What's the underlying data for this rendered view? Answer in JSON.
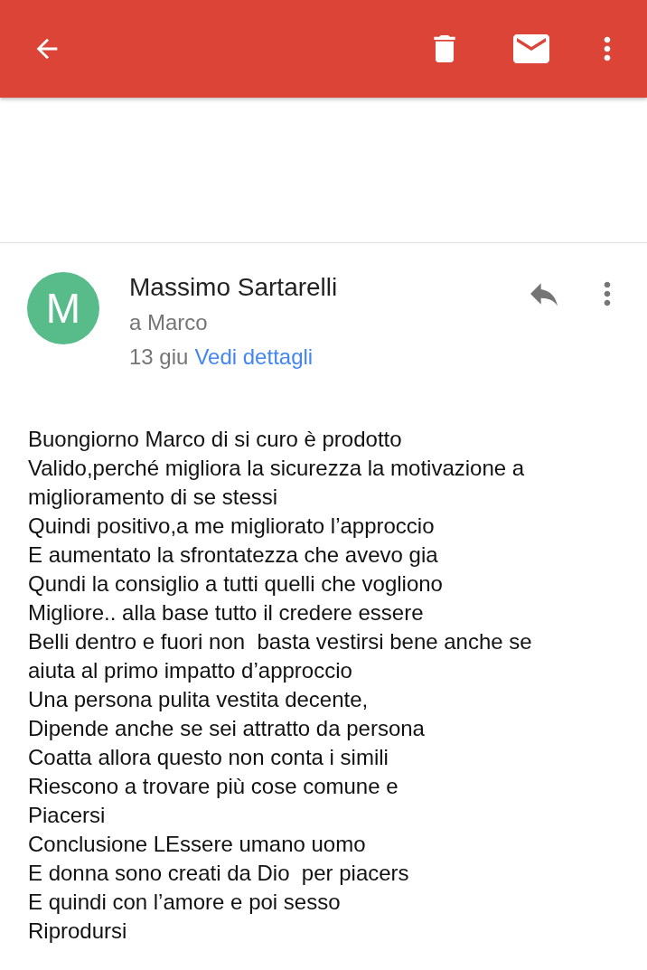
{
  "toolbar": {
    "actions": [
      {
        "kind": "back"
      },
      {
        "kind": "delete"
      },
      {
        "kind": "unread"
      },
      {
        "kind": "more"
      }
    ]
  },
  "message": {
    "sender": "Massimo Sartarelli",
    "avatar_letter": "M",
    "recipient": "a Marco",
    "date": "13 giu",
    "details_link": "Vedi dettagli",
    "body_lines": [
      "Buongiorno Marco di si curo è prodotto",
      "Valido,perché migliora la sicurezza la motivazione a",
      "miglioramento di se stessi",
      "Quindi positivo,a me migliorato l’approccio",
      "E aumentato la sfrontatezza che avevo gia",
      "Qundi la consiglio a tutti quelli che vogliono",
      "Migliore.. alla base tutto il credere essere",
      "Belli dentro e fuori non  basta vestirsi bene anche se",
      "aiuta al primo impatto d’approccio",
      "Una persona pulita vestita decente,",
      "Dipende anche se sei attratto da persona",
      "Coatta allora questo non conta i simili",
      "Riescono a trovare più cose comune e",
      "Piacersi",
      "Conclusione LEssere umano uomo",
      "E donna sono creati da Dio  per piacers",
      "E quindi con l’amore e poi sesso",
      "Riprodursi"
    ]
  }
}
